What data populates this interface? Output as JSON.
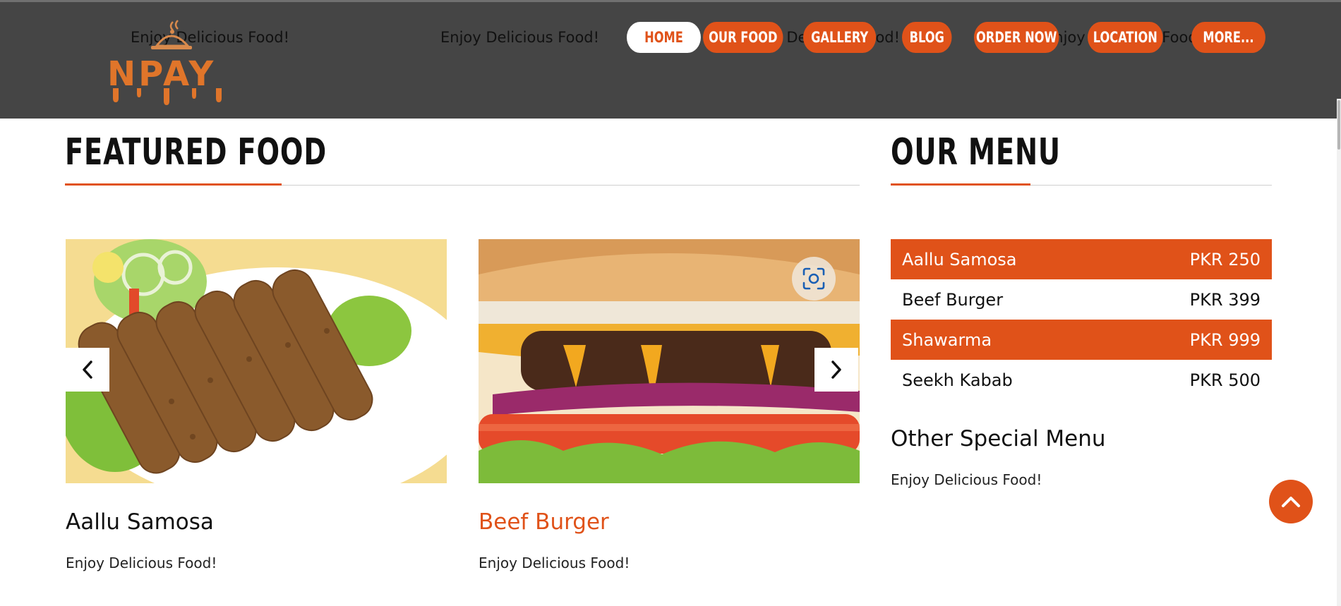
{
  "header": {
    "marquee": [
      "Enjoy Delicious Food!",
      "Enjoy Delicious Food!",
      "Enjoy Delicious Food!",
      "Enjoy Delicious Food!",
      "Enjoy Delicious Food!"
    ],
    "logo_text": "NPAY",
    "nav": [
      {
        "label": "HOME",
        "active": true
      },
      {
        "label": "OUR FOOD"
      },
      {
        "label": "GALLERY"
      },
      {
        "label": "BLOG"
      },
      {
        "label": "ORDER NOW"
      },
      {
        "label": "LOCATION"
      },
      {
        "label": "MORE..."
      }
    ]
  },
  "featured": {
    "title": "FEATURED FOOD",
    "cards": [
      {
        "image": "seekh-kabab-photo",
        "title": "Aallu Samosa",
        "text": "Enjoy Delicious Food!"
      },
      {
        "image": "beef-burger-photo",
        "title": "Beef Burger",
        "text": "Enjoy Delicious Food!"
      }
    ],
    "prev_icon": "chevron-left-icon",
    "next_icon": "chevron-right-icon",
    "lens_icon": "visual-search-icon"
  },
  "menu": {
    "title": "OUR MENU",
    "items": [
      {
        "name": "Aallu Samosa",
        "price": "PKR 250",
        "highlight": true
      },
      {
        "name": "Beef Burger",
        "price": "PKR 399",
        "highlight": false
      },
      {
        "name": "Shawarma",
        "price": "PKR 999",
        "highlight": true
      },
      {
        "name": "Seekh Kabab",
        "price": "PKR 500",
        "highlight": false
      }
    ],
    "other_title": "Other Special Menu",
    "other_text": "Enjoy Delicious Food!"
  },
  "scroll_top_icon": "chevron-up-icon",
  "colors": {
    "accent": "#e05219",
    "header_bg": "#454545",
    "title_highlight": "#e05219"
  }
}
